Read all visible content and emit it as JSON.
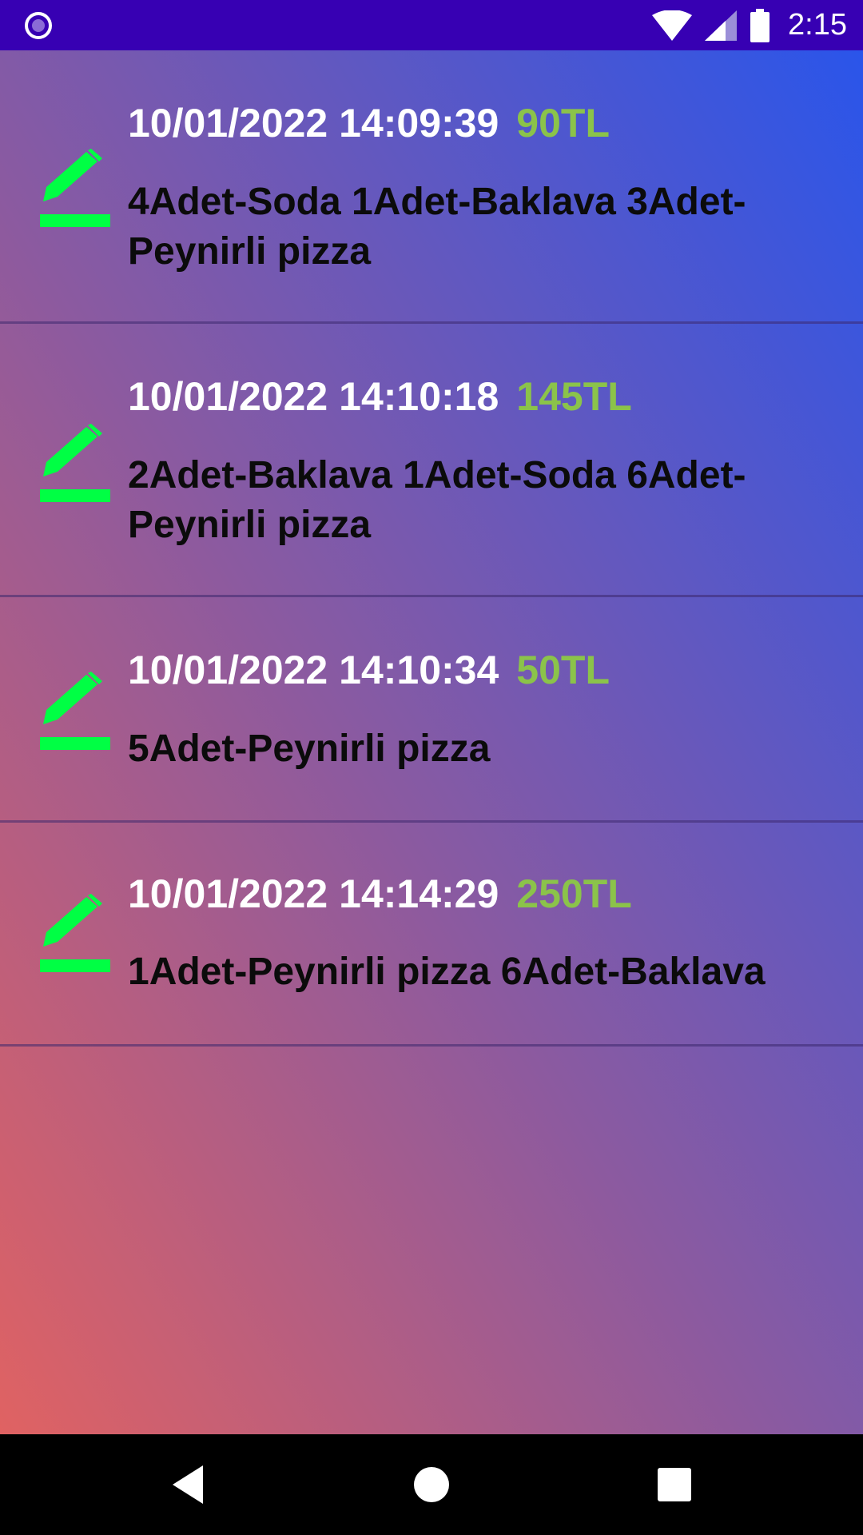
{
  "status_bar": {
    "time": "2:15",
    "left_icon": "circle-dot-icon",
    "right_icons": [
      "wifi-icon",
      "signal-icon",
      "battery-icon"
    ]
  },
  "orders": [
    {
      "datetime": "10/01/2022 14:09:39",
      "price": "90TL",
      "items": "4Adet-Soda 1Adet-Baklava 3Adet-Peynirli pizza",
      "icon": "edit-icon"
    },
    {
      "datetime": "10/01/2022 14:10:18",
      "price": "145TL",
      "items": "2Adet-Baklava 1Adet-Soda 6Adet-Peynirli pizza",
      "icon": "edit-icon"
    },
    {
      "datetime": "10/01/2022 14:10:34",
      "price": "50TL",
      "items": "5Adet-Peynirli pizza",
      "icon": "edit-icon"
    },
    {
      "datetime": "10/01/2022 14:14:29",
      "price": "250TL",
      "items": "1Adet-Peynirli pizza 6Adet-Baklava",
      "icon": "edit-icon"
    }
  ],
  "nav_bar": {
    "buttons": [
      "back-icon",
      "home-icon",
      "recents-icon"
    ]
  },
  "colors": {
    "status_bar": "#3700b3",
    "price": "#8bc34a",
    "edit_icon": "#00ff44",
    "gradient_top_right": "#2a55ea",
    "gradient_bottom_left": "#e06262"
  }
}
